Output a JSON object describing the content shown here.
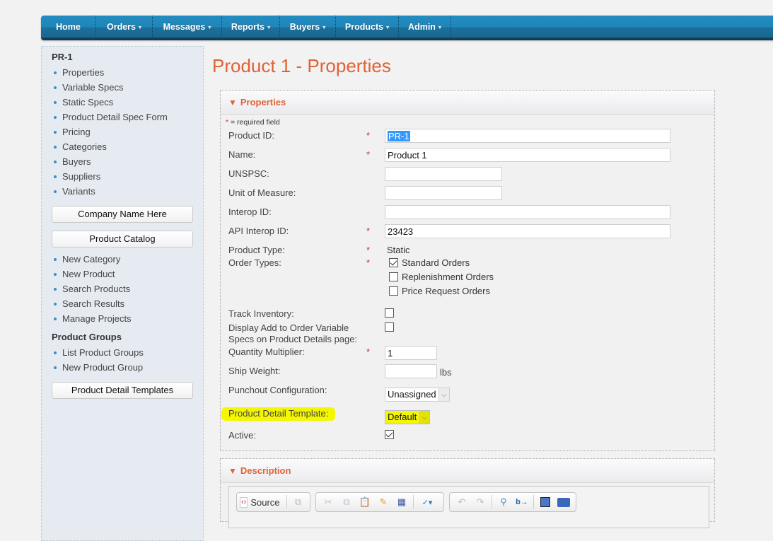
{
  "nav": {
    "items": [
      {
        "label": "Home",
        "caret": false
      },
      {
        "label": "Orders",
        "caret": true
      },
      {
        "label": "Messages",
        "caret": true
      },
      {
        "label": "Reports",
        "caret": true
      },
      {
        "label": "Buyers",
        "caret": true
      },
      {
        "label": "Products",
        "caret": true
      },
      {
        "label": "Admin",
        "caret": true
      }
    ],
    "caret_glyph": "▾"
  },
  "sidebar": {
    "product_title": "PR-1",
    "product_links": [
      "Properties",
      "Variable Specs",
      "Static Specs",
      "Product Detail Spec Form",
      "Pricing",
      "Categories",
      "Buyers",
      "Suppliers",
      "Variants"
    ],
    "company_button": "Company Name Here",
    "catalog_button": "Product Catalog",
    "catalog_links": [
      "New Category",
      "New Product",
      "Search Products",
      "Search Results",
      "Manage Projects"
    ],
    "groups_title": "Product Groups",
    "groups_links": [
      "List Product Groups",
      "New Product Group"
    ],
    "templates_button": "Product Detail Templates"
  },
  "page": {
    "title": "Product 1 - Properties"
  },
  "properties": {
    "header": "Properties",
    "collapse_glyph": "▼",
    "required_star": "*",
    "required_note": " = required field",
    "fields": {
      "product_id": {
        "label": "Product ID:",
        "value": "PR-1"
      },
      "name": {
        "label": "Name:",
        "value": "Product 1"
      },
      "unspsc": {
        "label": "UNSPSC:",
        "value": ""
      },
      "uom": {
        "label": "Unit of Measure:",
        "value": ""
      },
      "interop_id": {
        "label": "Interop ID:",
        "value": ""
      },
      "api_interop_id": {
        "label": "API Interop ID:",
        "value": "23423"
      },
      "product_type": {
        "label": "Product Type:",
        "value": "Static"
      },
      "order_types": {
        "label": "Order Types:",
        "options": [
          {
            "label": "Standard Orders",
            "checked": true
          },
          {
            "label": "Replenishment Orders",
            "checked": false
          },
          {
            "label": "Price Request Orders",
            "checked": false
          }
        ]
      },
      "track_inventory": {
        "label": "Track Inventory:",
        "checked": false
      },
      "display_add_to_order": {
        "label_line1": "Display Add to Order Variable",
        "label_line2": "Specs on Product Details page:",
        "checked": false
      },
      "quantity_multiplier": {
        "label": "Quantity Multiplier:",
        "value": "1"
      },
      "ship_weight": {
        "label": "Ship Weight:",
        "value": "",
        "unit": "lbs"
      },
      "punchout_configuration": {
        "label": "Punchout Configuration:",
        "selected": "Unassigned"
      },
      "product_detail_template": {
        "label": "Product Detail Template:",
        "selected": "Default"
      },
      "active": {
        "label": "Active:",
        "checked": true
      }
    }
  },
  "description": {
    "header": "Description",
    "toolbar": {
      "source_label": "Source"
    }
  },
  "colors": {
    "accent": "#e06234",
    "nav_blue": "#1f86ba",
    "highlight": "#f4f700",
    "required": "#d03030"
  }
}
